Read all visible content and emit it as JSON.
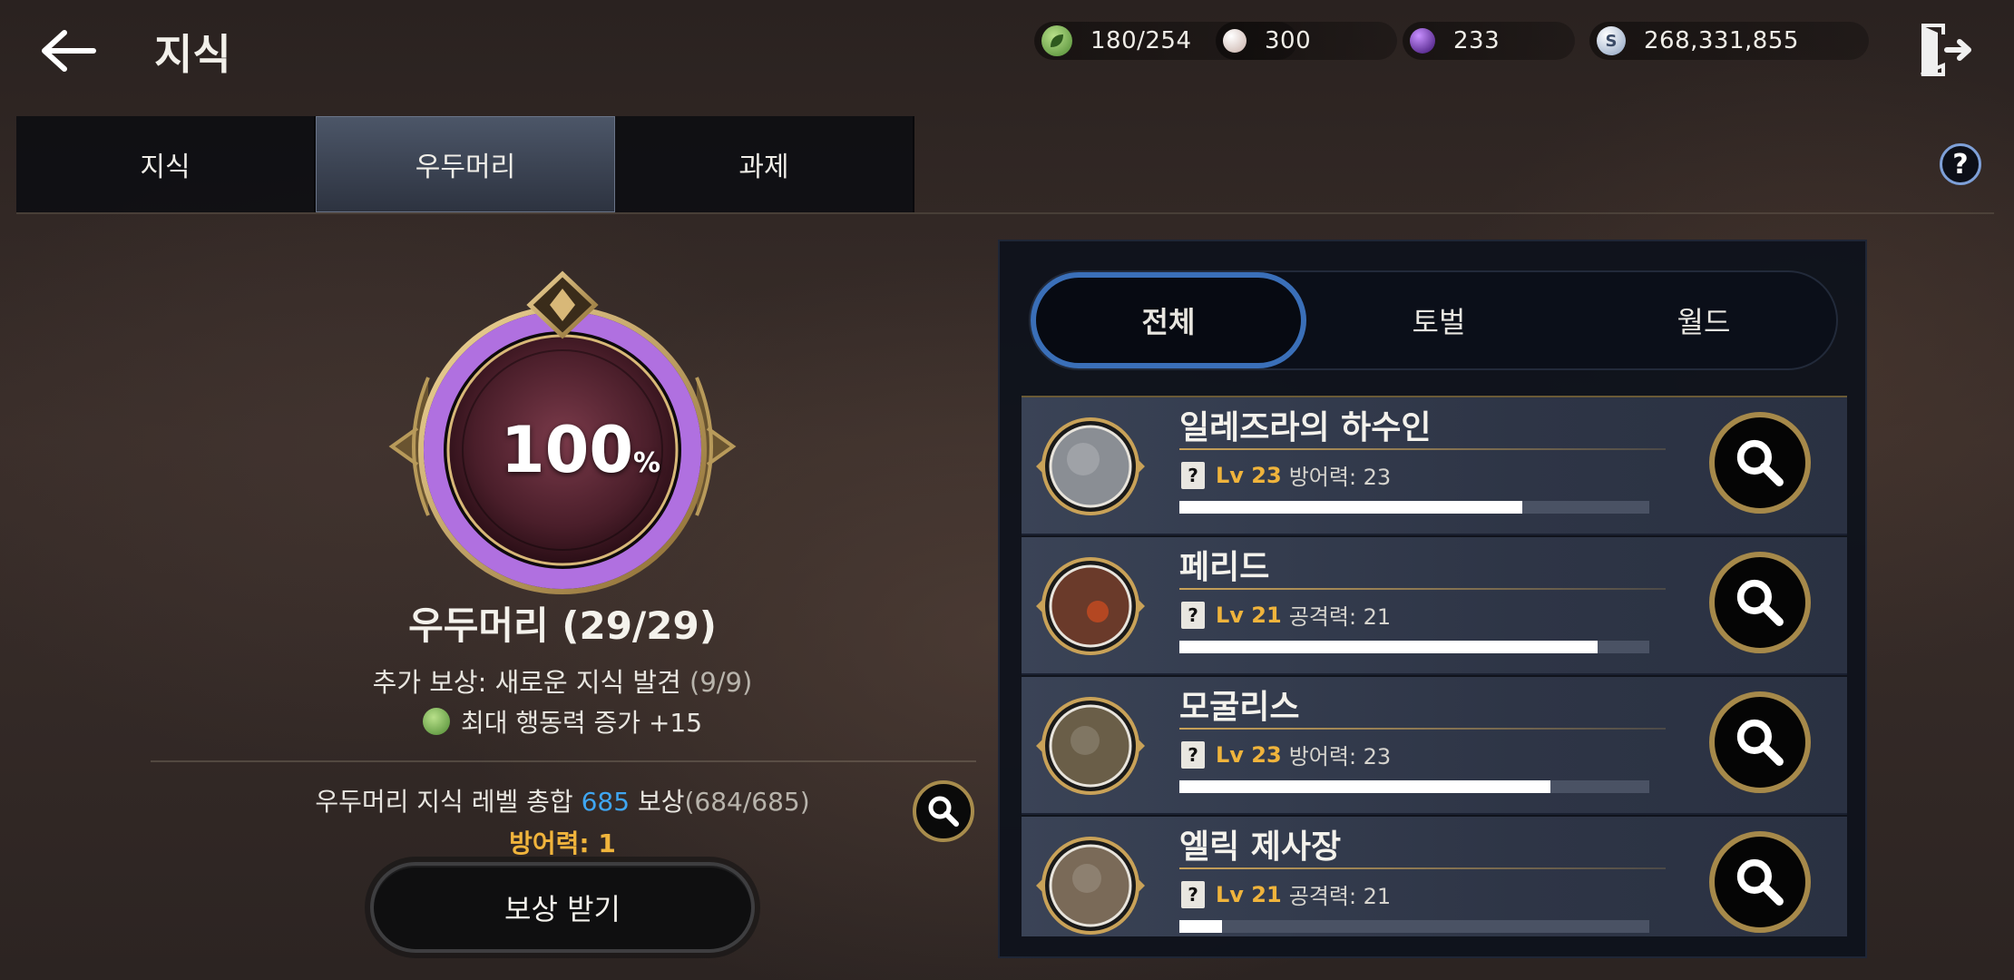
{
  "header": {
    "title": "지식",
    "currencies": [
      {
        "icon": "energy-leaf-icon",
        "value": "180/254",
        "color": "#7ab65a"
      },
      {
        "icon": "pearl-icon",
        "value": "300",
        "color": "#e8d8d0"
      },
      {
        "icon": "purple-orb-icon",
        "value": "233",
        "color": "#7a3ac8"
      },
      {
        "icon": "silver-coin-icon",
        "value": "268,331,855",
        "color": "#bcc8dc"
      }
    ]
  },
  "tabs": [
    {
      "label": "지식",
      "active": false
    },
    {
      "label": "우두머리",
      "active": true
    },
    {
      "label": "과제",
      "active": false
    }
  ],
  "summary": {
    "percent": "100",
    "percent_unit": "%",
    "title": "우두머리 (29/29)",
    "bonus_label": "추가 보상: 새로운 지식 발견",
    "bonus_count": "(9/9)",
    "effect_text": "최대 행동력 증가 +15",
    "total_prefix": "우두머리 지식 레벨 총합",
    "total_value": "685",
    "total_suffix": "보상",
    "total_progress": "(684/685)",
    "stat_reward": "방어력: 1",
    "reward_button": "보상 받기"
  },
  "filters": [
    {
      "label": "전체",
      "active": true
    },
    {
      "label": "토벌",
      "active": false
    },
    {
      "label": "월드",
      "active": false
    }
  ],
  "bosses": [
    {
      "name": "일레즈라의 하수인",
      "level": "Lv 23",
      "stat": "방어력: 23",
      "progress": 0.73,
      "portrait_color": "#8a8e94"
    },
    {
      "name": "페리드",
      "level": "Lv 21",
      "stat": "공격력: 21",
      "progress": 0.89,
      "portrait_color": "#6a3a2a"
    },
    {
      "name": "모굴리스",
      "level": "Lv 23",
      "stat": "방어력: 23",
      "progress": 0.79,
      "portrait_color": "#6a5e48"
    },
    {
      "name": "엘릭 제사장",
      "level": "Lv 21",
      "stat": "공격력: 21",
      "progress": 0.09,
      "portrait_color": "#7a6a58"
    }
  ]
}
